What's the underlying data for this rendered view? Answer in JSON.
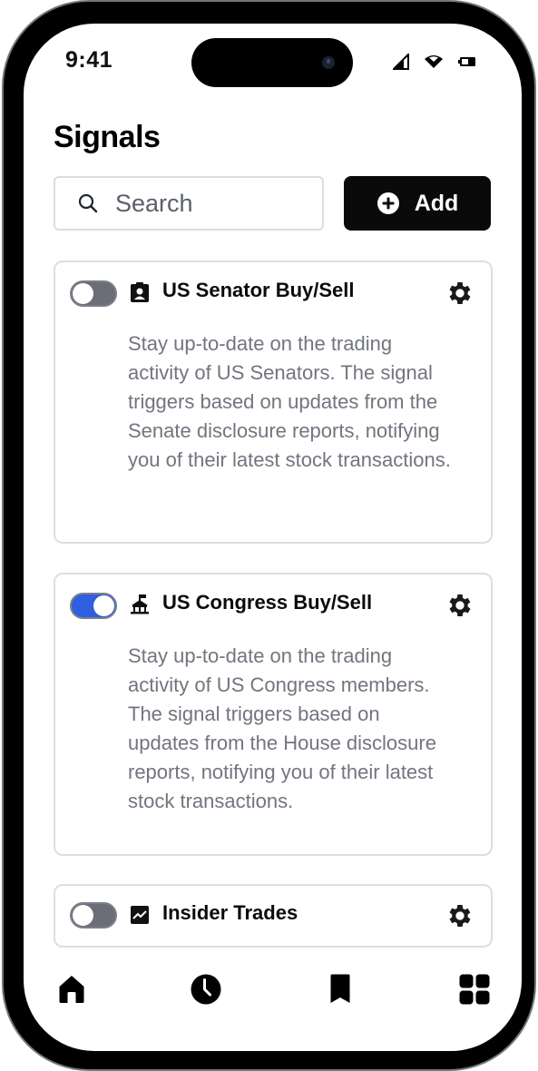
{
  "status_bar": {
    "time": "9:41",
    "icons": [
      "cellular-signal-icon",
      "wifi-icon",
      "battery-icon"
    ]
  },
  "page": {
    "title": "Signals"
  },
  "search": {
    "placeholder": "Search",
    "value": "",
    "icon": "search-icon"
  },
  "add_button": {
    "label": "Add",
    "icon": "plus-circle-icon"
  },
  "colors": {
    "toggle_on": "#2f5fe0",
    "toggle_off": "#6b6d78",
    "description_text": "#72757f",
    "primary_button": "#0a0a0b"
  },
  "signals": [
    {
      "title": "US Senator Buy/Sell",
      "icon": "id-badge-icon",
      "enabled": false,
      "description": "Stay up-to-date on the trading activity of US Senators. The signal triggers based on updates from the Senate disclosure reports, notifying you of their latest stock transactions."
    },
    {
      "title": "US Congress Buy/Sell",
      "icon": "capitol-building-icon",
      "enabled": true,
      "description": "Stay up-to-date on the trading activity of US Congress members. The signal triggers based on updates from the House disclosure reports, notifying you of their latest stock transactions."
    },
    {
      "title": "Insider Trades",
      "icon": "chart-line-icon",
      "enabled": false,
      "description": ""
    }
  ],
  "tab_bar": [
    {
      "name": "home",
      "icon": "home-icon"
    },
    {
      "name": "history",
      "icon": "clock-icon"
    },
    {
      "name": "saved",
      "icon": "bookmark-icon"
    },
    {
      "name": "apps",
      "icon": "grid-icon"
    }
  ]
}
